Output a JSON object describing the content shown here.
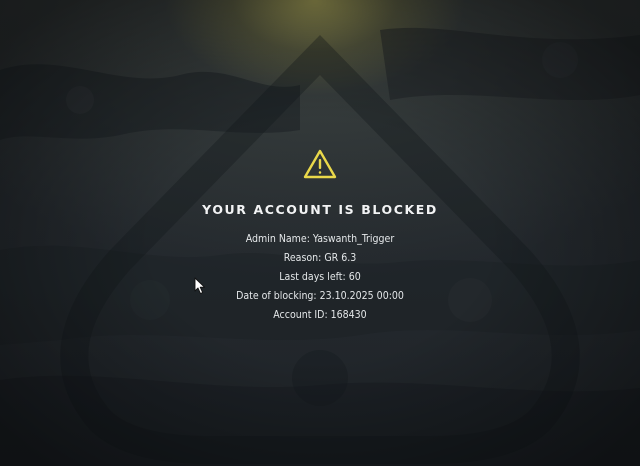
{
  "screen": {
    "icon": "warning-triangle-icon",
    "accent_color": "#e9d84a",
    "title": "YOUR ACCOUNT IS BLOCKED",
    "details": {
      "admin_name": "Admin Name: Yaswanth_Trigger",
      "reason": "Reason: GR 6.3",
      "days_left": "Last days left: 60",
      "date_blocked": "Date of blocking: 23.10.2025 00:00",
      "account_id": "Account ID: 168430"
    }
  },
  "cursor": {
    "icon": "mouse-pointer-icon"
  }
}
